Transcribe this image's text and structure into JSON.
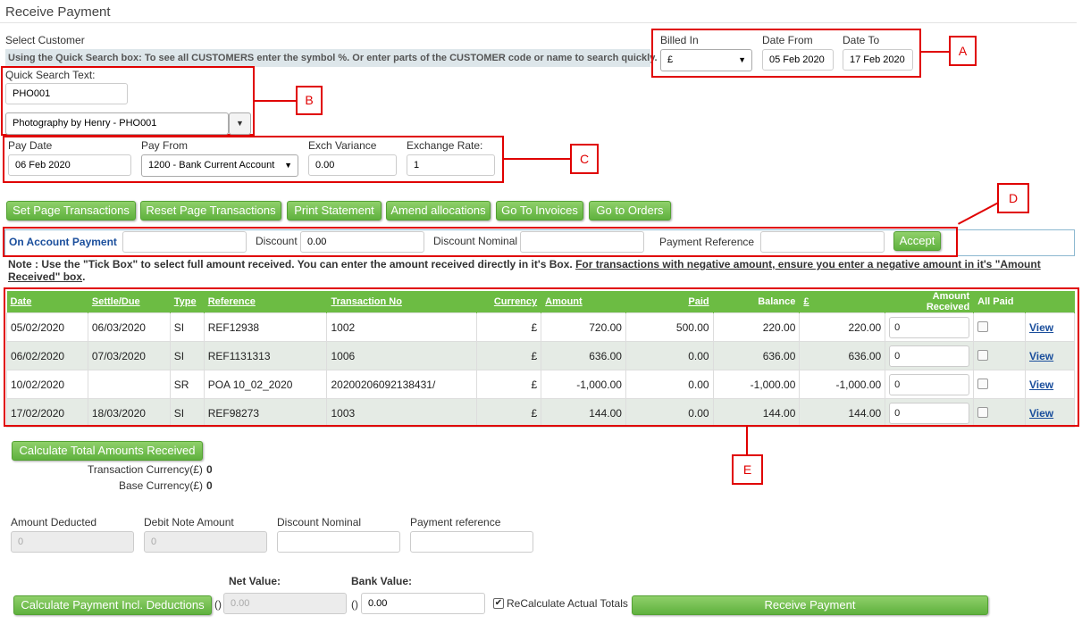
{
  "page_title": "Receive Payment",
  "select_customer_label": "Select Customer",
  "hint_text": "Using the Quick Search box: To see all CUSTOMERS enter the symbol %. Or enter parts of the CUSTOMER code or name to search quickly.",
  "billing": {
    "billed_in_label": "Billed In",
    "billed_in_value": "£",
    "date_from_label": "Date From",
    "date_from_value": "05 Feb 2020",
    "date_to_label": "Date To",
    "date_to_value": "17 Feb 2020"
  },
  "quick_search": {
    "label": "Quick Search Text:",
    "value": "PHO001",
    "customer_selected": "Photography by Henry - PHO001"
  },
  "payment": {
    "pay_date_label": "Pay Date",
    "pay_date_value": "06 Feb 2020",
    "pay_from_label": "Pay From",
    "pay_from_value": "1200 - Bank Current Account",
    "exch_variance_label": "Exch Variance",
    "exch_variance_value": "0.00",
    "exchange_rate_label": "Exchange Rate:",
    "exchange_rate_value": "1"
  },
  "callouts": {
    "a": "A",
    "b": "B",
    "c": "C",
    "d": "D",
    "e": "E"
  },
  "toolbar": {
    "set_page": "Set Page Transactions",
    "reset_page": "Reset Page Transactions",
    "print_statement": "Print Statement",
    "amend_allocations": "Amend allocations",
    "go_invoices": "Go To Invoices",
    "go_orders": "Go to Orders"
  },
  "on_account": {
    "label": "On Account Payment",
    "value": "",
    "discount_label": "Discount",
    "discount_value": "0.00",
    "discount_nominal_label": "Discount Nominal",
    "discount_nominal_value": "",
    "payment_reference_label": "Payment Reference",
    "payment_reference_value": "",
    "accept": "Accept"
  },
  "note": {
    "text": "Note : Use the \"Tick Box\" to select full amount received. You can enter the amount received directly in it's Box.",
    "underlined_line1": "For transactions with negative amount, ensure you enter a negative amount in it's \"Amount",
    "underlined_line2": "Received\" box",
    "end": "."
  },
  "table": {
    "headers": {
      "date": "Date",
      "settle": "Settle/Due",
      "type": "Type",
      "reference": "Reference",
      "transaction_no": "Transaction No",
      "currency": "Currency",
      "amount": "Amount",
      "paid": "Paid",
      "balance": "Balance",
      "base": "£",
      "amount_received": "Amount Received",
      "all_paid": "All Paid"
    },
    "rows": [
      {
        "date": "05/02/2020",
        "settle": "06/03/2020",
        "type": "SI",
        "reference": "REF12938",
        "transaction_no": "1002",
        "currency": "£",
        "amount": "720.00",
        "paid": "500.00",
        "balance": "220.00",
        "base": "220.00",
        "received": "0",
        "view": "View"
      },
      {
        "date": "06/02/2020",
        "settle": "07/03/2020",
        "type": "SI",
        "reference": "REF1131313",
        "transaction_no": "1006",
        "currency": "£",
        "amount": "636.00",
        "paid": "0.00",
        "balance": "636.00",
        "base": "636.00",
        "received": "0",
        "view": "View"
      },
      {
        "date": "10/02/2020",
        "settle": "",
        "type": "SR",
        "reference": "POA 10_02_2020",
        "transaction_no": "20200206092138431/",
        "currency": "£",
        "amount": "-1,000.00",
        "paid": "0.00",
        "balance": "-1,000.00",
        "base": "-1,000.00",
        "received": "0",
        "view": "View"
      },
      {
        "date": "17/02/2020",
        "settle": "18/03/2020",
        "type": "SI",
        "reference": "REF98273",
        "transaction_no": "1003",
        "currency": "£",
        "amount": "144.00",
        "paid": "0.00",
        "balance": "144.00",
        "base": "144.00",
        "received": "0",
        "view": "View"
      }
    ]
  },
  "totals": {
    "calculate_label": "Calculate Total Amounts Received",
    "transaction_currency_label": "Transaction Currency(£)",
    "transaction_currency_value": "0",
    "base_currency_label": "Base Currency(£)",
    "base_currency_value": "0"
  },
  "deductions": {
    "amount_deducted_label": "Amount Deducted",
    "amount_deducted_placeholder": "0",
    "debit_note_label": "Debit Note Amount",
    "debit_note_placeholder": "0",
    "discount_nominal_label": "Discount Nominal",
    "payment_reference_label": "Payment reference"
  },
  "bottom": {
    "net_value_label": "Net Value:",
    "net_value_prefix": "()",
    "net_value": "0.00",
    "bank_value_label": "Bank Value:",
    "bank_value_prefix": "()",
    "bank_value": "0.00",
    "calc_payment_label": "Calculate Payment Incl. Deductions",
    "recalc_label": "ReCalculate Actual Totals",
    "receive_payment": "Receive Payment"
  },
  "colors": {
    "accent_green": "#6cbc43",
    "annotation_red": "#e00000",
    "link_blue": "#1a4e9c"
  }
}
